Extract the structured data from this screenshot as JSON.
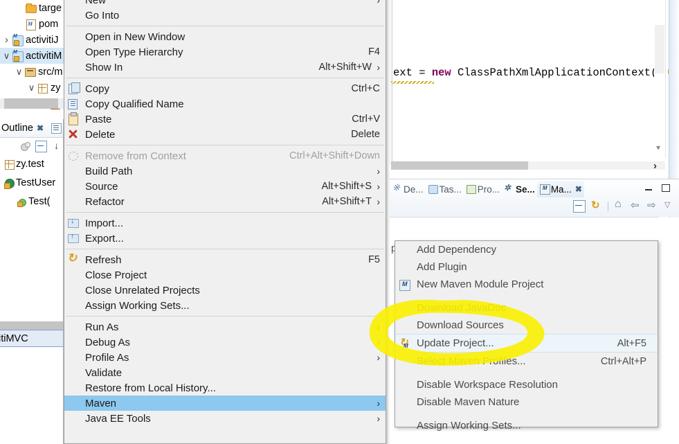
{
  "explorer": {
    "items": [
      {
        "label": "targe",
        "icon": "folder-icon",
        "twisty": "",
        "indent": 22,
        "selected": false
      },
      {
        "label": "pom",
        "icon": "pom-icon",
        "twisty": "",
        "indent": 22,
        "selected": false
      },
      {
        "label": "activitiJ",
        "icon": "maven-project-icon",
        "twisty": "right",
        "indent": 3,
        "selected": false
      },
      {
        "label": "activitiM",
        "icon": "maven-project-icon",
        "twisty": "down",
        "indent": 3,
        "selected": true
      },
      {
        "label": "src/m",
        "icon": "source-folder-icon",
        "twisty": "down",
        "indent": 21,
        "selected": false
      },
      {
        "label": "zy",
        "icon": "package-icon",
        "twisty": "down",
        "indent": 39,
        "selected": false
      },
      {
        "label": "",
        "icon": "package-alt-icon",
        "twisty": "right",
        "indent": 57,
        "selected": false
      }
    ]
  },
  "outline": {
    "title": "Outline",
    "close_label": "✖",
    "items": [
      {
        "label": "zy.test",
        "icon": "package-icon",
        "indent": 4
      },
      {
        "label": "TestUser",
        "icon": "class-icon",
        "indent": 4
      },
      {
        "label": "Test(",
        "icon": "method-icon",
        "indent": 22
      }
    ]
  },
  "status_tip": {
    "text": "itiMVC"
  },
  "editor": {
    "code_prefix": "ext = ",
    "code_keyword": "new",
    "code_body": " ClassPathXmlApplicationContext(",
    "code_quote": "\""
  },
  "views": {
    "tabs": [
      {
        "label": "De...",
        "icon": "debug-icon",
        "state": "normal"
      },
      {
        "label": "Tas...",
        "icon": "tasks-icon",
        "state": "normal"
      },
      {
        "label": "Pro...",
        "icon": "problems-icon",
        "state": "normal"
      },
      {
        "label": "Se...",
        "icon": "servers-icon",
        "state": "bold"
      },
      {
        "label": "Ma...",
        "icon": "maven-repo-icon",
        "state": "active"
      }
    ],
    "minimize_label": "Minimize",
    "maximize_label": "Maximize",
    "toolbar": [
      {
        "name": "collapse-all-icon"
      },
      {
        "name": "refresh-icon"
      },
      {
        "name": "home-icon"
      },
      {
        "name": "back-icon"
      },
      {
        "name": "forward-icon"
      },
      {
        "name": "view-menu-icon"
      }
    ],
    "content_text": "po)"
  },
  "context_menu": {
    "items": [
      {
        "label": "New",
        "accel": "",
        "arrow": true,
        "icon": "",
        "disabled": false
      },
      {
        "label": "Go Into",
        "accel": "",
        "arrow": false,
        "icon": "",
        "disabled": false
      },
      {
        "type": "separator"
      },
      {
        "label": "Open in New Window",
        "accel": "",
        "arrow": false,
        "icon": "",
        "disabled": false
      },
      {
        "label": "Open Type Hierarchy",
        "accel": "F4",
        "arrow": false,
        "icon": "",
        "disabled": false
      },
      {
        "label": "Show In",
        "accel": "Alt+Shift+W",
        "arrow": true,
        "icon": "",
        "disabled": false
      },
      {
        "type": "separator"
      },
      {
        "label": "Copy",
        "accel": "Ctrl+C",
        "arrow": false,
        "icon": "copy-icon",
        "disabled": false
      },
      {
        "label": "Copy Qualified Name",
        "accel": "",
        "arrow": false,
        "icon": "copy-qualified-icon",
        "disabled": false
      },
      {
        "label": "Paste",
        "accel": "Ctrl+V",
        "arrow": false,
        "icon": "paste-icon",
        "disabled": false
      },
      {
        "label": "Delete",
        "accel": "Delete",
        "arrow": false,
        "icon": "delete-icon",
        "disabled": false
      },
      {
        "type": "separator"
      },
      {
        "label": "Remove from Context",
        "accel": "Ctrl+Alt+Shift+Down",
        "arrow": false,
        "icon": "remove-context-icon",
        "disabled": true
      },
      {
        "label": "Build Path",
        "accel": "",
        "arrow": true,
        "icon": "",
        "disabled": false
      },
      {
        "label": "Source",
        "accel": "Alt+Shift+S",
        "arrow": true,
        "icon": "",
        "disabled": false
      },
      {
        "label": "Refactor",
        "accel": "Alt+Shift+T",
        "arrow": true,
        "icon": "",
        "disabled": false
      },
      {
        "type": "separator"
      },
      {
        "label": "Import...",
        "accel": "",
        "arrow": false,
        "icon": "import-icon",
        "disabled": false
      },
      {
        "label": "Export...",
        "accel": "",
        "arrow": false,
        "icon": "export-icon",
        "disabled": false
      },
      {
        "type": "separator"
      },
      {
        "label": "Refresh",
        "accel": "F5",
        "arrow": false,
        "icon": "refresh-icon",
        "disabled": false
      },
      {
        "label": "Close Project",
        "accel": "",
        "arrow": false,
        "icon": "",
        "disabled": false
      },
      {
        "label": "Close Unrelated Projects",
        "accel": "",
        "arrow": false,
        "icon": "",
        "disabled": false
      },
      {
        "label": "Assign Working Sets...",
        "accel": "",
        "arrow": false,
        "icon": "",
        "disabled": false
      },
      {
        "type": "separator"
      },
      {
        "label": "Run As",
        "accel": "",
        "arrow": true,
        "icon": "",
        "disabled": false
      },
      {
        "label": "Debug As",
        "accel": "",
        "arrow": true,
        "icon": "",
        "disabled": false
      },
      {
        "label": "Profile As",
        "accel": "",
        "arrow": true,
        "icon": "",
        "disabled": false
      },
      {
        "label": "Validate",
        "accel": "",
        "arrow": false,
        "icon": "",
        "disabled": false
      },
      {
        "label": "Restore from Local History...",
        "accel": "",
        "arrow": false,
        "icon": "",
        "disabled": false
      },
      {
        "label": "Maven",
        "accel": "",
        "arrow": true,
        "icon": "",
        "disabled": false,
        "selected": true
      },
      {
        "label": "Java EE Tools",
        "accel": "",
        "arrow": true,
        "icon": "",
        "disabled": false
      }
    ],
    "selected_color": "#8cc8ef"
  },
  "submenu": {
    "items": [
      {
        "label": "Add Dependency",
        "accel": "",
        "icon": ""
      },
      {
        "label": "Add Plugin",
        "accel": "",
        "icon": ""
      },
      {
        "label": "New Maven Module Project",
        "accel": "",
        "icon": "new-maven-module-icon"
      },
      {
        "type": "separator"
      },
      {
        "label": "Download JavaDoc",
        "accel": "",
        "icon": ""
      },
      {
        "label": "Download Sources",
        "accel": "",
        "icon": ""
      },
      {
        "label": "Update Project...",
        "accel": "Alt+F5",
        "icon": "update-project-icon",
        "hover": true
      },
      {
        "label": "Select Maven Profiles...",
        "accel": "Ctrl+Alt+P",
        "icon": ""
      },
      {
        "type": "separator"
      },
      {
        "label": "Disable Workspace Resolution",
        "accel": "",
        "icon": ""
      },
      {
        "label": "Disable Maven Nature",
        "accel": "",
        "icon": ""
      },
      {
        "type": "separator"
      },
      {
        "label": "Assign Working Sets...",
        "accel": "",
        "icon": ""
      }
    ]
  },
  "annotation": {
    "type": "highlighter-ellipse",
    "color": "#f9f000",
    "target": "Update Project..."
  }
}
